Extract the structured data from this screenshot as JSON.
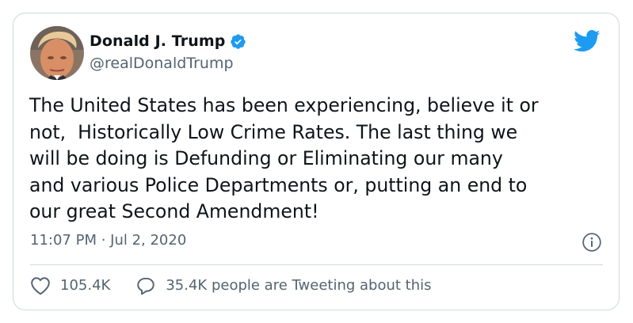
{
  "author": {
    "display_name": "Donald J. Trump",
    "handle": "@realDonaldTrump",
    "verified": true
  },
  "tweet": {
    "text": "The United States has been experiencing, believe it or\nnot,  Historically Low Crime Rates. The last thing we\nwill be doing is Defunding or Eliminating our many\nand various Police Departments or, putting an end to\nour great Second Amendment!",
    "timestamp": "11:07 PM · Jul 2, 2020"
  },
  "engagement": {
    "likes": "105.4K",
    "conversation": "35.4K people are Tweeting about this"
  },
  "icons": {
    "brand": "twitter-bird-icon",
    "verified": "verified-badge-icon",
    "info": "info-icon",
    "like": "heart-icon",
    "reply": "speech-bubble-icon"
  },
  "colors": {
    "brand": "#1d9bf0",
    "text": "#0f1419",
    "muted": "#536471",
    "border": "#cfd9de"
  }
}
